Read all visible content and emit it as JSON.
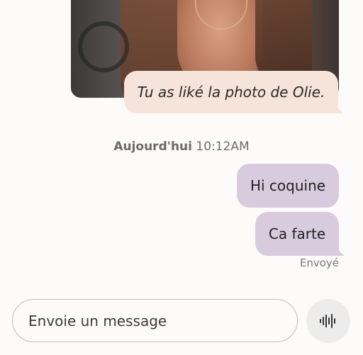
{
  "conversation": {
    "liked_notice": "Tu as liké la photo de Olie.",
    "timestamp": {
      "day": "Aujourd'hui",
      "time": "10:12AM"
    },
    "messages": [
      {
        "text": "Hi coquine"
      },
      {
        "text": "Ca farte"
      }
    ],
    "status": "Envoyé"
  },
  "composer": {
    "placeholder": "Envoie un message",
    "voice_icon": "voice-waveform-icon"
  },
  "colors": {
    "liked_bubble": "#f6e3da",
    "sent_bubble": "#d9cbde",
    "background": "#fdfbf9"
  }
}
